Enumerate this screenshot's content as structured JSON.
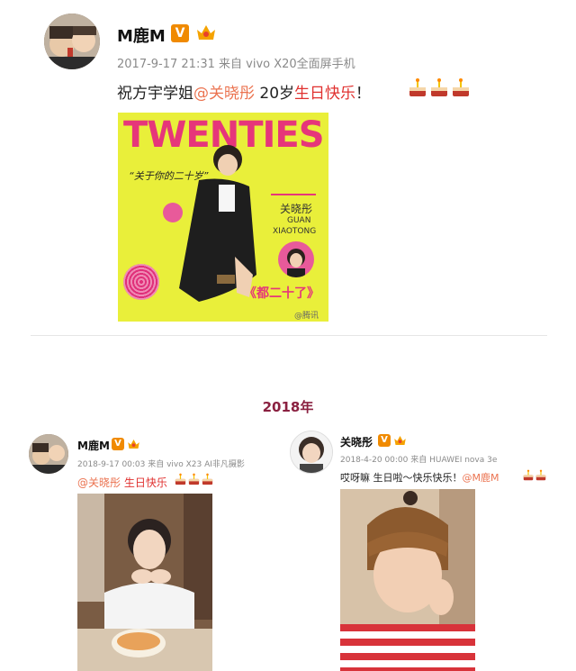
{
  "post1": {
    "author": "M鹿M",
    "meta": "2017-9-17 21:31 来自 vivo X20全面屏手机",
    "text_pre": "祝方宇学姐",
    "mention": "@关晓彤",
    "text_mid": " 20岁",
    "text_red": "生日快乐",
    "text_end": "！",
    "poster": {
      "title": "TWENTIES",
      "quote": "“关于你的二十岁”",
      "name_cn": "关晓彤",
      "name_en1": "GUAN",
      "name_en2": "XIAOTONG",
      "book": "《都二十了》",
      "watermark": "@腾讯"
    }
  },
  "year_label": "2018年",
  "post2": {
    "author": "M鹿M",
    "meta": "2018-9-17 00:03 来自 vivo X23 AI非凡摄影",
    "mention": "@关晓彤",
    "text_red": " 生日快乐"
  },
  "post3": {
    "author": "关晓彤",
    "meta": "2018-4-20 00:00 来自 HUAWEI nova 3e",
    "text": "哎呀嘛 生日啦～快乐快乐！",
    "mention": "@M鹿M"
  },
  "colors": {
    "poster_bg": "#e9ef3a",
    "poster_title": "#e6367a",
    "mention": "#eb7350",
    "red_text": "#e0312f",
    "badge": "#f08a00"
  },
  "icons": [
    "verified-v-icon",
    "crown-icon",
    "cake-icon"
  ]
}
